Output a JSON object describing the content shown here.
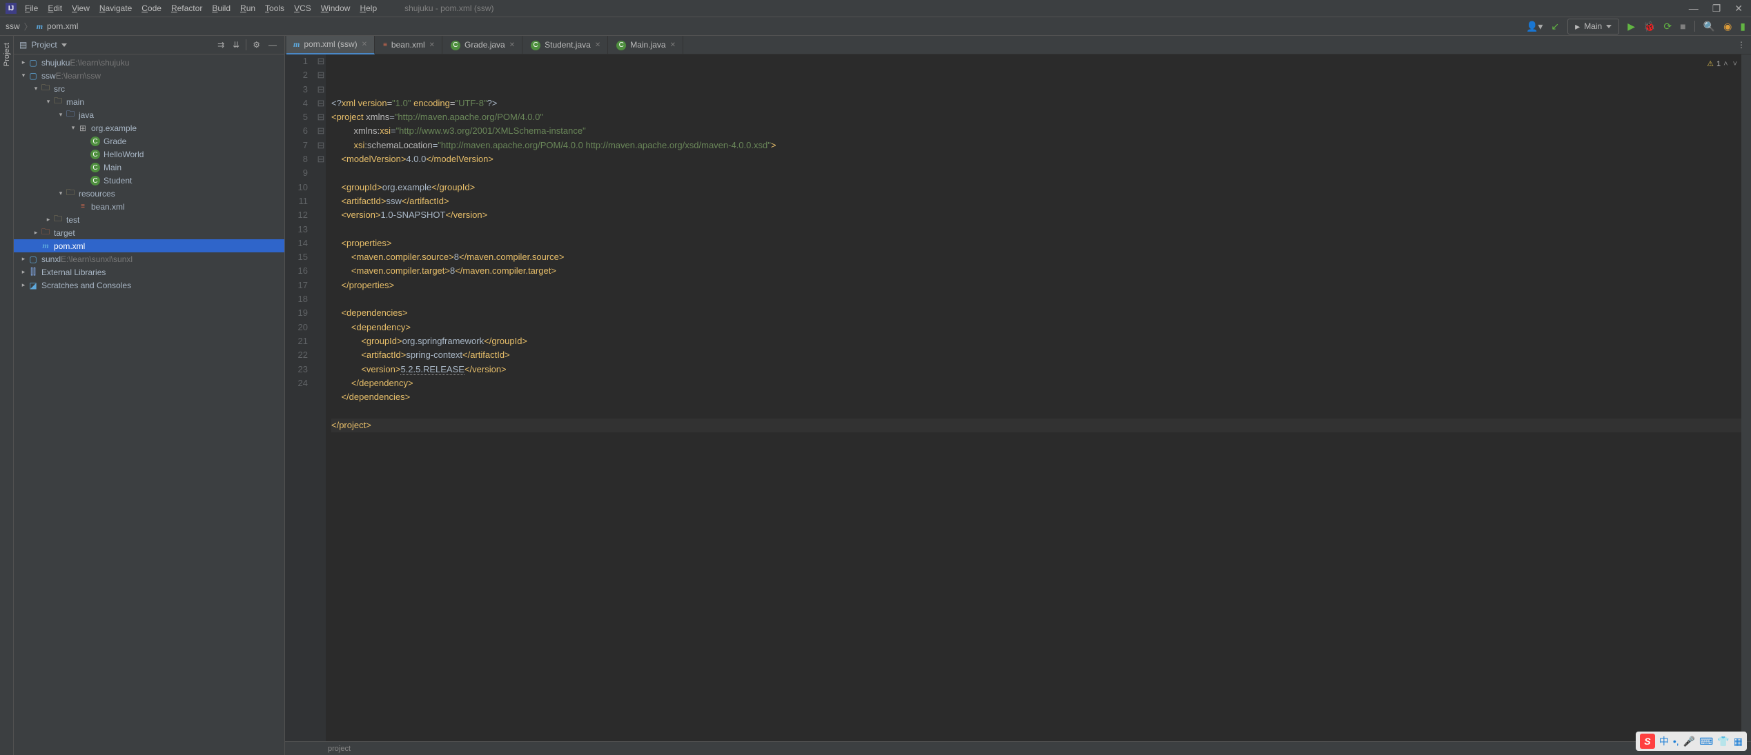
{
  "titlebar": {
    "menu": [
      "File",
      "Edit",
      "View",
      "Navigate",
      "Code",
      "Refactor",
      "Build",
      "Run",
      "Tools",
      "VCS",
      "Window",
      "Help"
    ],
    "title": "shujuku - pom.xml (ssw)"
  },
  "breadcrumb": {
    "root": "ssw",
    "file": "pom.xml"
  },
  "run_config": {
    "label": "Main"
  },
  "project_panel": {
    "title": "Project"
  },
  "tree": {
    "nodes": [
      {
        "depth": 0,
        "arrow": "right",
        "icon": "module",
        "label": "shujuku",
        "hint": "E:\\learn\\shujuku"
      },
      {
        "depth": 0,
        "arrow": "down",
        "icon": "module",
        "label": "ssw",
        "hint": "E:\\learn\\ssw"
      },
      {
        "depth": 1,
        "arrow": "down",
        "icon": "folder",
        "label": "src"
      },
      {
        "depth": 2,
        "arrow": "down",
        "icon": "folder",
        "label": "main"
      },
      {
        "depth": 3,
        "arrow": "down",
        "icon": "source",
        "label": "java"
      },
      {
        "depth": 4,
        "arrow": "down",
        "icon": "package",
        "label": "org.example"
      },
      {
        "depth": 5,
        "arrow": "",
        "icon": "class",
        "label": "Grade"
      },
      {
        "depth": 5,
        "arrow": "",
        "icon": "class",
        "label": "HelloWorld"
      },
      {
        "depth": 5,
        "arrow": "",
        "icon": "runclass",
        "label": "Main"
      },
      {
        "depth": 5,
        "arrow": "",
        "icon": "class",
        "label": "Student"
      },
      {
        "depth": 3,
        "arrow": "down",
        "icon": "resource",
        "label": "resources"
      },
      {
        "depth": 4,
        "arrow": "",
        "icon": "xml",
        "label": "bean.xml"
      },
      {
        "depth": 2,
        "arrow": "right",
        "icon": "folder",
        "label": "test"
      },
      {
        "depth": 1,
        "arrow": "right",
        "icon": "target",
        "label": "target"
      },
      {
        "depth": 1,
        "arrow": "",
        "icon": "maven",
        "label": "pom.xml",
        "selected": true
      },
      {
        "depth": 0,
        "arrow": "right",
        "icon": "module",
        "label": "sunxl",
        "hint": "E:\\learn\\sunxl\\sunxl"
      },
      {
        "depth": 0,
        "arrow": "right",
        "icon": "library",
        "label": "External Libraries"
      },
      {
        "depth": 0,
        "arrow": "right",
        "icon": "scratch",
        "label": "Scratches and Consoles"
      }
    ]
  },
  "tabs": [
    {
      "icon": "maven",
      "label": "pom.xml (ssw)",
      "active": true
    },
    {
      "icon": "xml",
      "label": "bean.xml"
    },
    {
      "icon": "class",
      "label": "Grade.java"
    },
    {
      "icon": "class",
      "label": "Student.java"
    },
    {
      "icon": "runclass",
      "label": "Main.java"
    }
  ],
  "warnings": {
    "count": "1"
  },
  "code": {
    "lines": [
      {
        "n": 1,
        "fold": "",
        "html": "&lt;?<span class='tag'>xml version</span><span class='attr-name'>=</span><span class='attr-val'>\"1.0\"</span> <span class='tag'>encoding</span><span class='attr-name'>=</span><span class='attr-val'>\"UTF-8\"</span>?&gt;"
      },
      {
        "n": 2,
        "fold": "⊟",
        "html": "<span class='tag'>&lt;project</span> <span class='attr-name'>xmlns</span>=<span class='attr-val'>\"http://maven.apache.org/POM/4.0.0\"</span>"
      },
      {
        "n": 3,
        "fold": "",
        "html": "         <span class='attr-name'>xmlns:</span><span class='tag'>xsi</span>=<span class='attr-val'>\"http://www.w3.org/2001/XMLSchema-instance\"</span>"
      },
      {
        "n": 4,
        "fold": "",
        "html": "         <span class='tag'>xsi</span><span class='attr-name'>:schemaLocation</span>=<span class='attr-val'>\"http://maven.apache.org/POM/4.0.0 http://maven.apache.org/xsd/maven-4.0.0.xsd\"</span><span class='tag'>&gt;</span>"
      },
      {
        "n": 5,
        "fold": "",
        "html": "    <span class='tag'>&lt;modelVersion&gt;</span>4.0.0<span class='tag'>&lt;/modelVersion&gt;</span>"
      },
      {
        "n": 6,
        "fold": "",
        "html": ""
      },
      {
        "n": 7,
        "fold": "",
        "html": "    <span class='tag'>&lt;groupId&gt;</span>org.example<span class='tag'>&lt;/groupId&gt;</span>"
      },
      {
        "n": 8,
        "fold": "",
        "html": "    <span class='tag'>&lt;artifactId&gt;</span>ssw<span class='tag'>&lt;/artifactId&gt;</span>"
      },
      {
        "n": 9,
        "fold": "",
        "html": "    <span class='tag'>&lt;version&gt;</span>1.0-SNAPSHOT<span class='tag'>&lt;/version&gt;</span>"
      },
      {
        "n": 10,
        "fold": "",
        "html": ""
      },
      {
        "n": 11,
        "fold": "⊟",
        "html": "    <span class='tag'>&lt;properties&gt;</span>"
      },
      {
        "n": 12,
        "fold": "",
        "html": "        <span class='tag'>&lt;maven.compiler.source&gt;</span>8<span class='tag'>&lt;/maven.compiler.source&gt;</span>"
      },
      {
        "n": 13,
        "fold": "",
        "html": "        <span class='tag'>&lt;maven.compiler.target&gt;</span>8<span class='tag'>&lt;/maven.compiler.target&gt;</span>"
      },
      {
        "n": 14,
        "fold": "⊟",
        "html": "    <span class='tag'>&lt;/properties&gt;</span>"
      },
      {
        "n": 15,
        "fold": "",
        "html": ""
      },
      {
        "n": 16,
        "fold": "⊟",
        "html": "    <span class='tag'>&lt;dependencies&gt;</span>"
      },
      {
        "n": 17,
        "fold": "⊟",
        "html": "        <span class='tag'>&lt;dependency&gt;</span>"
      },
      {
        "n": 18,
        "fold": "",
        "html": "            <span class='tag'>&lt;groupId&gt;</span>org.springframework<span class='tag'>&lt;/groupId&gt;</span>"
      },
      {
        "n": 19,
        "fold": "",
        "html": "            <span class='tag'>&lt;artifactId&gt;</span>spring-context<span class='tag'>&lt;/artifactId&gt;</span>"
      },
      {
        "n": 20,
        "fold": "",
        "html": "            <span class='tag'>&lt;version&gt;</span><span class='underline-val'>5.2.5.RELEASE</span><span class='tag'>&lt;/version&gt;</span>"
      },
      {
        "n": 21,
        "fold": "⊟",
        "html": "        <span class='tag'>&lt;/dependency&gt;</span>"
      },
      {
        "n": 22,
        "fold": "⊟",
        "html": "    <span class='tag'>&lt;/dependencies&gt;</span>"
      },
      {
        "n": 23,
        "fold": "",
        "html": ""
      },
      {
        "n": 24,
        "fold": "⊟",
        "hl": true,
        "html": "<span class='tag'>&lt;/project&gt;</span>"
      }
    ]
  },
  "bottom_crumb": "project",
  "sidebar_gutter": {
    "label": "Project"
  }
}
